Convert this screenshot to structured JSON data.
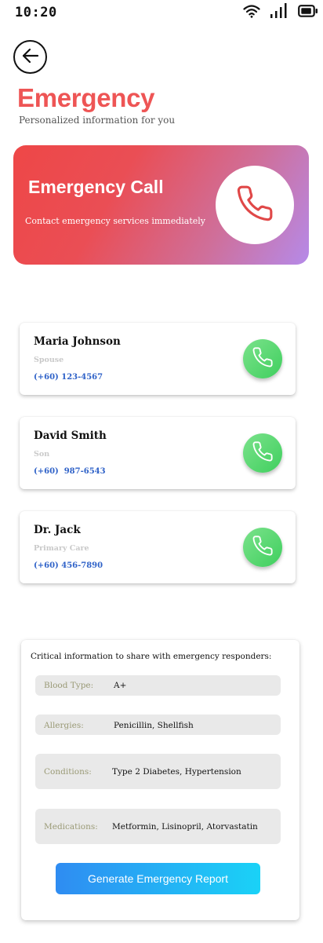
{
  "status_bar": {
    "time": "10:20",
    "icons": [
      "wifi-icon",
      "signal-icon",
      "battery-icon"
    ]
  },
  "header": {
    "back_icon": "arrow-left-icon",
    "title": "Emergency",
    "subtitle": "Personalized information for you"
  },
  "emergency_call": {
    "title": "Emergency Call",
    "description": "Contact emergency services immediately",
    "icon": "phone-icon"
  },
  "contacts": [
    {
      "name": "Maria Johnson",
      "relation": "Spouse",
      "phone": "(+60) 123-4567"
    },
    {
      "name": "David Smith",
      "relation": "Son",
      "phone": "(+60)  987-6543"
    },
    {
      "name": "Dr. Jack",
      "relation": "Primary Care",
      "phone": "(+60) 456-7890"
    }
  ],
  "medical_info": {
    "heading": "Critical information to share with emergency responders:",
    "rows": [
      {
        "label": "Blood Type:",
        "value": "A+"
      },
      {
        "label": "Allergies:",
        "value": "Penicillin, Shellfish"
      },
      {
        "label": "Conditions:",
        "value": "Type 2 Diabetes, Hypertension"
      },
      {
        "label": "Medications:",
        "value": "Metformin, Lisinopril, Atorvastatin"
      }
    ],
    "report_button": "Generate Emergency Report"
  },
  "colors": {
    "title_red": "#ee5555",
    "phone_blue": "#2f62c8",
    "call_green": "#3fcf5e",
    "label_olive": "#9a9a76"
  }
}
